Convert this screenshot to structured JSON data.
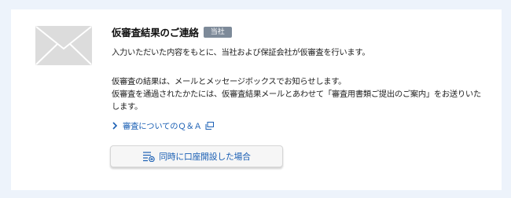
{
  "notice": {
    "title": "仮審査結果のご連絡",
    "badge": "当社",
    "paragraph1": "入力いただいた内容をもとに、当社および保証会社が仮審査を行います。",
    "paragraph2_line1": "仮審査の結果は、メールとメッセージボックスでお知らせします。",
    "paragraph2_line2": "仮審査を通過されたかたには、仮審査結果メールとあわせて「審査用書類ご提出のご案内」をお送りいたします。",
    "link_label": "審査についてのＱ＆Ａ",
    "button_label": "同時に口座開設した場合"
  },
  "icons": {
    "mail": "envelope-icon",
    "link_arrow": "chevron-right-icon",
    "external": "external-window-icon",
    "button": "list-add-icon"
  },
  "colors": {
    "page_background": "#edf3fb",
    "badge": "#7d8a99",
    "link": "#1a5fb4",
    "envelope": "#dcdcdc"
  }
}
